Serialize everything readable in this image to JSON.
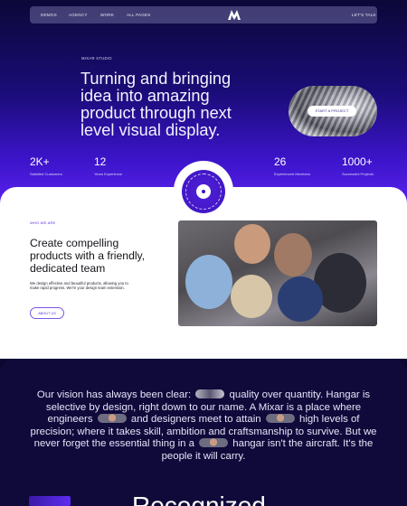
{
  "nav": {
    "links": [
      "DEMOS",
      "AGENCY",
      "WORK",
      "ALL PAGES"
    ],
    "cta": "LET'S TALK",
    "logo": "mixar-logo"
  },
  "hero": {
    "kicker": "MIXAR STUDIO",
    "headline_lines": [
      "Turning and bringing",
      "idea into amazing",
      "product through next",
      "level visual display."
    ],
    "cta_label": "START A PROJECT"
  },
  "stats": [
    {
      "num": "2K+",
      "label": "Satisfied Customers"
    },
    {
      "num": "12",
      "label": "Years Experience"
    },
    {
      "num": "26",
      "label": "Experienced Members"
    },
    {
      "num": "1000+",
      "label": "Successful Projects"
    }
  ],
  "about": {
    "tag": "WHO WE ARE",
    "heading_lines": [
      "Create compelling",
      "products with a friendly,",
      "dedicated team"
    ],
    "body": "We design effective and beautiful products, allowing you to make rapid progress. We're your design team extension.",
    "button": "ABOUT US"
  },
  "vision": {
    "parts": [
      "Our vision has always been clear:",
      "quality over quantity. Hangar is selective by design, right down to our name. A Mixar is a place where engineers",
      "and designers meet to attain",
      "high levels of precision; where it takes skill, ambition and craftsmanship to survive. But we never forget the essential thing in a",
      "hangar isn't the aircraft. It's the people it will carry."
    ]
  },
  "next_heading": "Recognized"
}
